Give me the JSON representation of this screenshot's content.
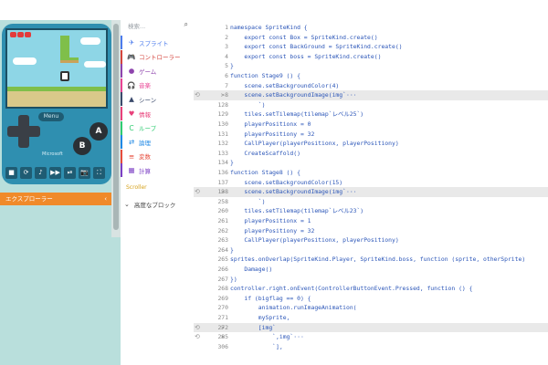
{
  "simulator": {
    "menu_label": "Menu",
    "btn_a": "A",
    "btn_b": "B",
    "brand": "Microsoft",
    "toolbar_icons": [
      "stop-icon",
      "restart-icon",
      "sound-icon",
      "step-icon",
      "slowmo-icon",
      "screenshot-icon",
      "fullscreen-icon"
    ],
    "toolbar_glyphs": [
      "■",
      "⟳",
      "♪",
      "▶▶",
      "⏯",
      "📷",
      "⛶"
    ],
    "explorer_label": "エクスプローラー"
  },
  "toolbox": {
    "search_placeholder": "検索...",
    "categories": [
      {
        "label": "スプライト",
        "color": "#4b7bec",
        "icon": "sprite-icon",
        "glyph": "✈"
      },
      {
        "label": "コントローラー",
        "color": "#d4443d",
        "icon": "controller-icon",
        "glyph": "🎮"
      },
      {
        "label": "ゲーム",
        "color": "#8e44ad",
        "icon": "game-icon",
        "glyph": "●"
      },
      {
        "label": "音楽",
        "color": "#e84393",
        "icon": "music-icon",
        "glyph": "🎧"
      },
      {
        "label": "シーン",
        "color": "#3a4a6b",
        "icon": "scene-icon",
        "glyph": "▲"
      },
      {
        "label": "情報",
        "color": "#e8407a",
        "icon": "info-icon",
        "glyph": "♥"
      },
      {
        "label": "ループ",
        "color": "#2ecc71",
        "icon": "loops-icon",
        "glyph": "C"
      },
      {
        "label": "論理",
        "color": "#1e88e5",
        "icon": "logic-icon",
        "glyph": "⇄"
      },
      {
        "label": "変数",
        "color": "#e74c3c",
        "icon": "variables-icon",
        "glyph": "≡"
      },
      {
        "label": "計算",
        "color": "#7b3fc4",
        "icon": "math-icon",
        "glyph": "▦"
      }
    ],
    "extensions_label": "Scroller",
    "advanced_label": "高度なブロック"
  },
  "editor": {
    "lines": [
      {
        "n": "1",
        "code": "namespace SpriteKind {",
        "fold": ""
      },
      {
        "n": "2",
        "code": "    export const Box = SpriteKind.create()",
        "fold": ""
      },
      {
        "n": "3",
        "code": "    export const BackGround = SpriteKind.create()",
        "fold": ""
      },
      {
        "n": "4",
        "code": "    export const boss = SpriteKind.create()",
        "fold": ""
      },
      {
        "n": "5",
        "code": "}",
        "fold": ""
      },
      {
        "n": "6",
        "code": "function Stage9 () {",
        "fold": ""
      },
      {
        "n": "7",
        "code": "    scene.setBackgroundColor(4)",
        "fold": ""
      },
      {
        "n": "8",
        "code": "    scene.setBackgroundImage(img`···",
        "fold": ">",
        "hl": true
      },
      {
        "n": "128",
        "code": "        `)",
        "fold": ""
      },
      {
        "n": "129",
        "code": "    tiles.setTilemap(tilemap`レベル25`)",
        "fold": ""
      },
      {
        "n": "130",
        "code": "    playerPositionx = 0",
        "fold": ""
      },
      {
        "n": "131",
        "code": "    playerPositiony = 32",
        "fold": ""
      },
      {
        "n": "132",
        "code": "    CallPlayer(playerPositionx, playerPositiony)",
        "fold": ""
      },
      {
        "n": "133",
        "code": "    CreateScaffold()",
        "fold": ""
      },
      {
        "n": "134",
        "code": "}",
        "fold": ""
      },
      {
        "n": "136",
        "code": "function Stage8 () {",
        "fold": ""
      },
      {
        "n": "137",
        "code": "    scene.setBackgroundColor(15)",
        "fold": ""
      },
      {
        "n": "138",
        "code": "    scene.setBackgroundImage(img`···",
        "fold": ">",
        "hl": true
      },
      {
        "n": "258",
        "code": "        `)",
        "fold": ""
      },
      {
        "n": "260",
        "code": "    tiles.setTilemap(tilemap`レベル23`)",
        "fold": ""
      },
      {
        "n": "261",
        "code": "    playerPositionx = 1",
        "fold": ""
      },
      {
        "n": "262",
        "code": "    playerPositiony = 32",
        "fold": ""
      },
      {
        "n": "263",
        "code": "    CallPlayer(playerPositionx, playerPositiony)",
        "fold": ""
      },
      {
        "n": "264",
        "code": "}",
        "fold": ""
      },
      {
        "n": "265",
        "code": "sprites.onOverlap(SpriteKind.Player, SpriteKind.boss, function (sprite, otherSprite)",
        "fold": ""
      },
      {
        "n": "266",
        "code": "    Damage()",
        "fold": ""
      },
      {
        "n": "267",
        "code": "})",
        "fold": ""
      },
      {
        "n": "268",
        "code": "controller.right.onEvent(ControllerButtonEvent.Pressed, function () {",
        "fold": ""
      },
      {
        "n": "269",
        "code": "    if (bigflag == 0) {",
        "fold": ""
      },
      {
        "n": "270",
        "code": "        animation.runImageAnimation(",
        "fold": ""
      },
      {
        "n": "271",
        "code": "        mySprite,",
        "fold": ""
      },
      {
        "n": "272",
        "code": "        [img`",
        "fold": ">",
        "hl": true
      },
      {
        "n": "285",
        "code": "            `,img`···",
        "fold": ">"
      },
      {
        "n": "306",
        "code": "            `],",
        "fold": ""
      }
    ]
  },
  "colors": {
    "sim_bg": "#b9dfdc",
    "device": "#2f8fb0",
    "explorer": "#f08a2a",
    "code_text": "#2a55b8",
    "extension_text": "#d6a21c"
  }
}
